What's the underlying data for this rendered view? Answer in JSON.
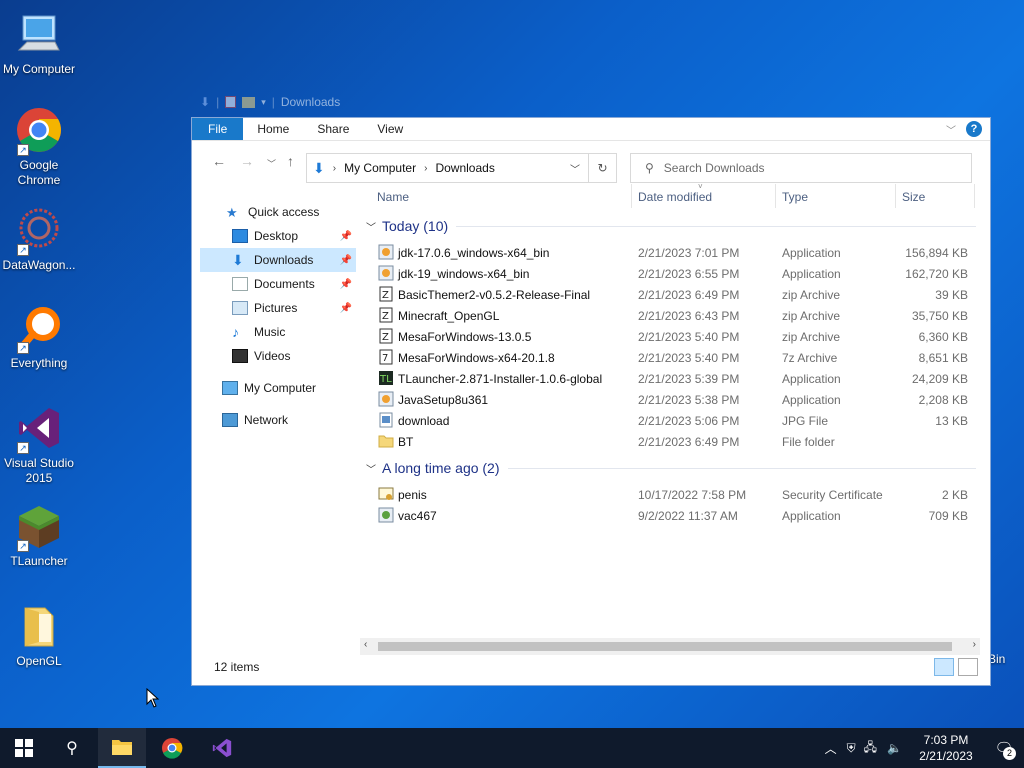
{
  "desktop": {
    "icons": [
      {
        "label": "My Computer"
      },
      {
        "label": "Google Chrome"
      },
      {
        "label": "DataWagon..."
      },
      {
        "label": "Everything"
      },
      {
        "label": "Visual Studio 2015"
      },
      {
        "label": "TLauncher"
      },
      {
        "label": "OpenGL"
      }
    ],
    "recycle_bin_partial_label": "Bin"
  },
  "quick_access_toolbar": {
    "title": "Downloads"
  },
  "ribbon": {
    "tabs": [
      "File",
      "Home",
      "Share",
      "View"
    ],
    "help": "?"
  },
  "address": {
    "crumbs": [
      "My Computer",
      "Downloads"
    ],
    "search_placeholder": "Search Downloads"
  },
  "nav_pane": {
    "quick_access": "Quick access",
    "items": [
      {
        "label": "Desktop",
        "pinned": true
      },
      {
        "label": "Downloads",
        "pinned": true,
        "selected": true
      },
      {
        "label": "Documents",
        "pinned": true
      },
      {
        "label": "Pictures",
        "pinned": true
      },
      {
        "label": "Music",
        "pinned": false
      },
      {
        "label": "Videos",
        "pinned": false
      }
    ],
    "my_computer": "My Computer",
    "network": "Network"
  },
  "columns": {
    "name": "Name",
    "date": "Date modified",
    "type": "Type",
    "size": "Size"
  },
  "groups": [
    {
      "title": "Today (10)",
      "files": [
        {
          "name": "jdk-17.0.6_windows-x64_bin",
          "date": "2/21/2023 7:01 PM",
          "type": "Application",
          "size": "156,894 KB",
          "icon": "installer-icon"
        },
        {
          "name": "jdk-19_windows-x64_bin",
          "date": "2/21/2023 6:55 PM",
          "type": "Application",
          "size": "162,720 KB",
          "icon": "installer-icon"
        },
        {
          "name": "BasicThemer2-v0.5.2-Release-Final",
          "date": "2/21/2023 6:49 PM",
          "type": "zip Archive",
          "size": "39 KB",
          "icon": "archive-icon"
        },
        {
          "name": "Minecraft_OpenGL",
          "date": "2/21/2023 6:43 PM",
          "type": "zip Archive",
          "size": "35,750 KB",
          "icon": "archive-icon"
        },
        {
          "name": "MesaForWindows-13.0.5",
          "date": "2/21/2023 5:40 PM",
          "type": "zip Archive",
          "size": "6,360 KB",
          "icon": "archive-icon"
        },
        {
          "name": "MesaForWindows-x64-20.1.8",
          "date": "2/21/2023 5:40 PM",
          "type": "7z Archive",
          "size": "8,651 KB",
          "icon": "archive-icon"
        },
        {
          "name": "TLauncher-2.871-Installer-1.0.6-global",
          "date": "2/21/2023 5:39 PM",
          "type": "Application",
          "size": "24,209 KB",
          "icon": "tlauncher-icon"
        },
        {
          "name": "JavaSetup8u361",
          "date": "2/21/2023 5:38 PM",
          "type": "Application",
          "size": "2,208 KB",
          "icon": "installer-icon"
        },
        {
          "name": "download",
          "date": "2/21/2023 5:06 PM",
          "type": "JPG File",
          "size": "13 KB",
          "icon": "image-icon"
        },
        {
          "name": "BT",
          "date": "2/21/2023 6:49 PM",
          "type": "File folder",
          "size": "",
          "icon": "folder-icon"
        }
      ]
    },
    {
      "title": "A long time ago (2)",
      "files": [
        {
          "name": "penis",
          "date": "10/17/2022 7:58 PM",
          "type": "Security Certificate",
          "size": "2 KB",
          "icon": "certificate-icon"
        },
        {
          "name": "vac467",
          "date": "9/2/2022 11:37 AM",
          "type": "Application",
          "size": "709 KB",
          "icon": "installer-icon"
        }
      ]
    }
  ],
  "status": {
    "count": "12 items"
  },
  "taskbar": {
    "time": "7:03 PM",
    "date": "2/21/2023",
    "notifications": "2"
  }
}
